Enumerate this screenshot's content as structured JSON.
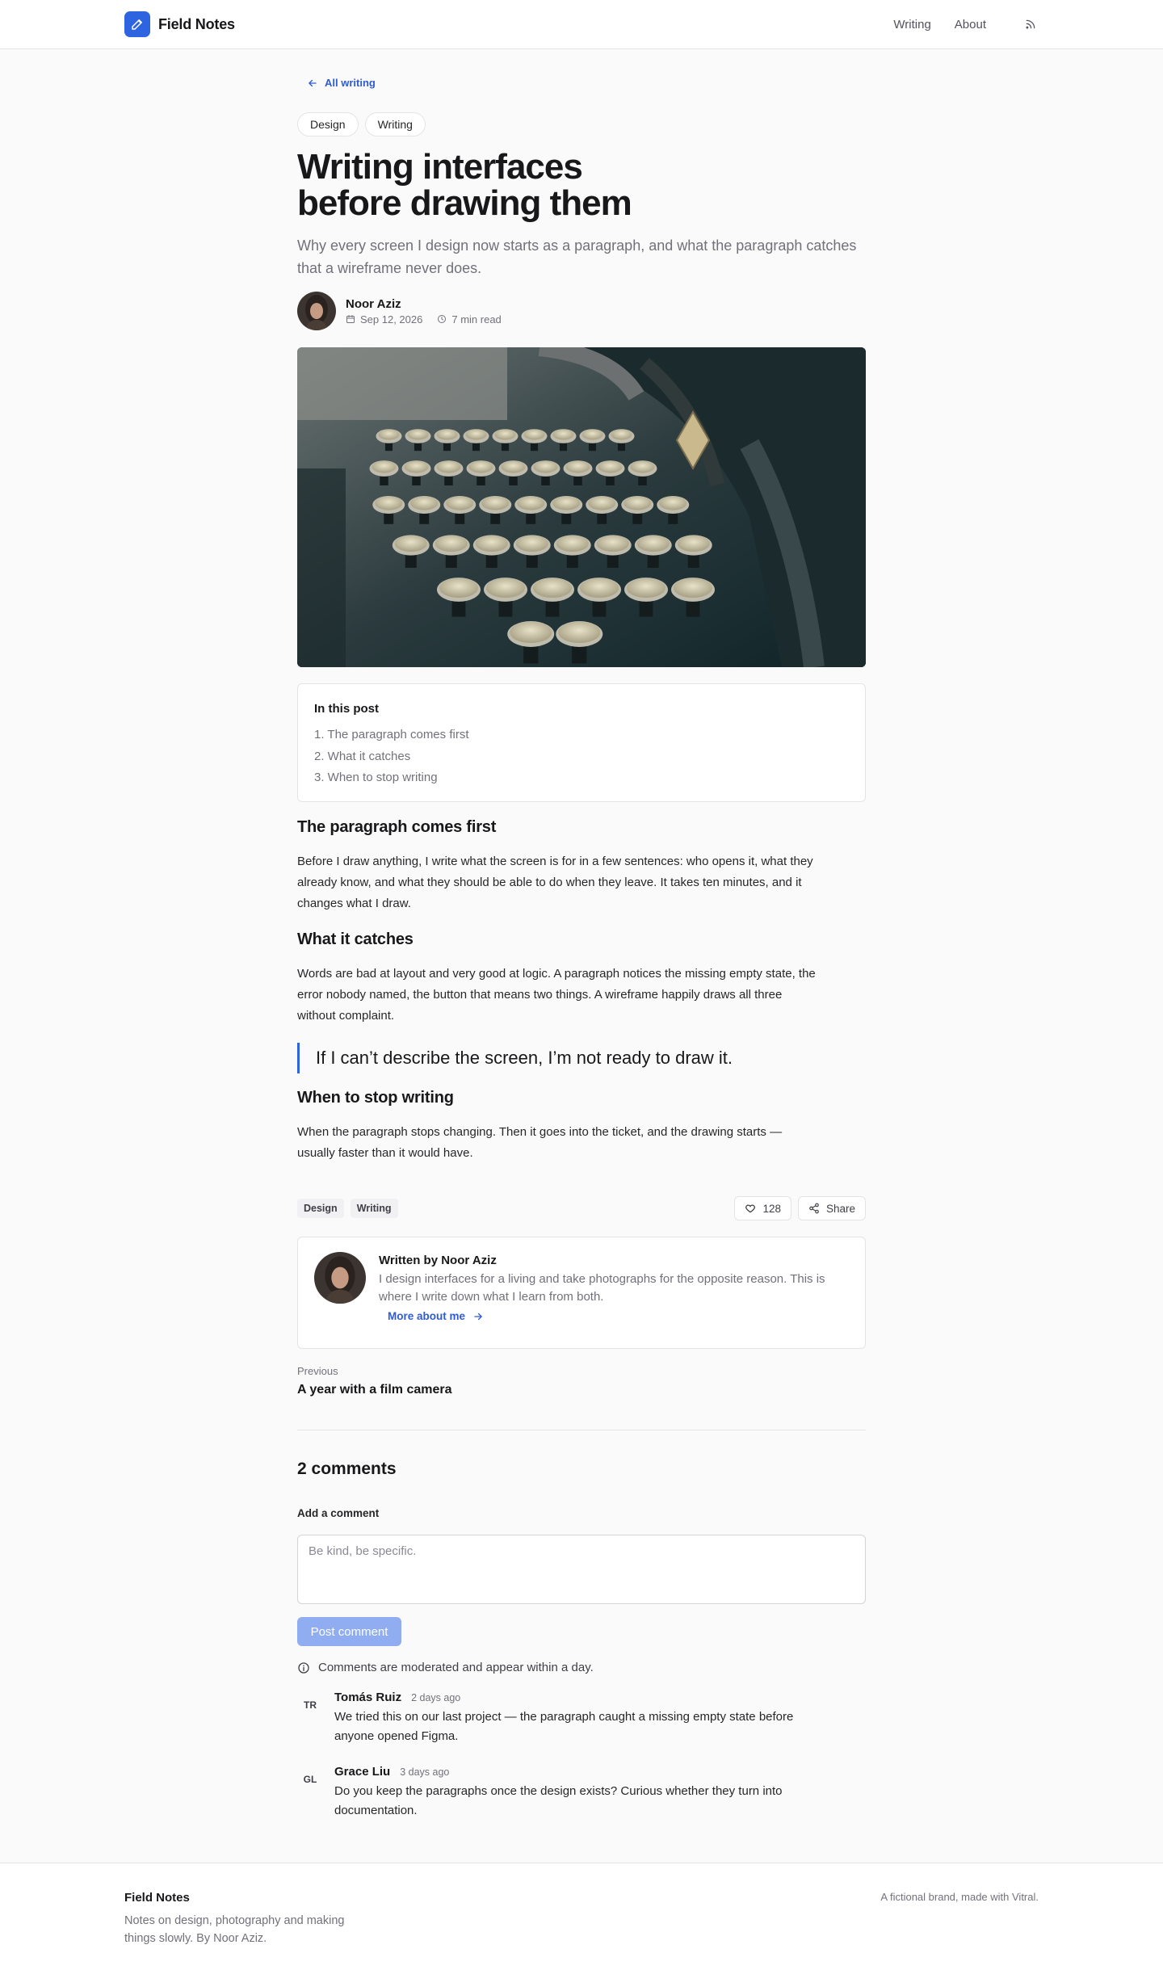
{
  "header": {
    "brand": "Field Notes",
    "nav": [
      "Writing",
      "About"
    ],
    "rss_icon": "rss-icon",
    "brand_color": "#2f64e0"
  },
  "post": {
    "back_link": "All writing",
    "categories": [
      "Design",
      "Writing"
    ],
    "title_line1": "Writing interfaces",
    "title_line2": "before drawing them",
    "subtitle": "Why every screen I design now starts as a paragraph, and what the paragraph catches that a wireframe never does.",
    "author": "Noor Aziz",
    "date": "Sep 12, 2026",
    "read_time": "7 min read"
  },
  "toc": {
    "title": "In this post",
    "items": [
      "1. The paragraph comes first",
      "2. What it catches",
      "3. When to stop writing"
    ]
  },
  "sections": [
    {
      "heading": "The paragraph comes first",
      "body": "Before I draw anything, I write what the screen is for in a few sentences: who opens it, what they already know, and what they should be able to do when they leave. It takes ten minutes, and it changes what I draw."
    },
    {
      "heading": "What it catches",
      "body": "Words are bad at layout and very good at logic. A paragraph notices the missing empty state, the error nobody named, the button that means two things. A wireframe happily draws all three without complaint."
    },
    {
      "heading": "When to stop writing",
      "body": "When the paragraph stops changing. Then it goes into the ticket, and the drawing starts — usually faster than it would have."
    }
  ],
  "quote": "If I can’t describe the screen, I’m not ready to draw it.",
  "footer_tags": [
    "Design",
    "Writing"
  ],
  "likes": "128",
  "share_label": "Share",
  "author_card": {
    "title": "Written by Noor Aziz",
    "bio": "I design interfaces for a living and take photographs for the opposite reason. This is where I write down what I learn from both.",
    "link": "More about me"
  },
  "previous": {
    "label": "Previous",
    "title": "A year with a film camera"
  },
  "comments": {
    "title": "2 comments",
    "add_label": "Add a comment",
    "placeholder": "Be kind, be specific.",
    "submit": "Post comment",
    "notice": "Comments are moderated and appear within a day.",
    "items": [
      {
        "initials": "TR",
        "name": "Tomás Ruiz",
        "time": "2 days ago",
        "text": "We tried this on our last project — the paragraph caught a missing empty state before anyone opened Figma."
      },
      {
        "initials": "GL",
        "name": "Grace Liu",
        "time": "3 days ago",
        "text": "Do you keep the paragraphs once the design exists? Curious whether they turn into documentation."
      }
    ]
  },
  "site_footer": {
    "brand": "Field Notes",
    "description": "Notes on design, photography and making things slowly. By Noor Aziz.",
    "credit": "A fictional brand, made with Vitral."
  }
}
